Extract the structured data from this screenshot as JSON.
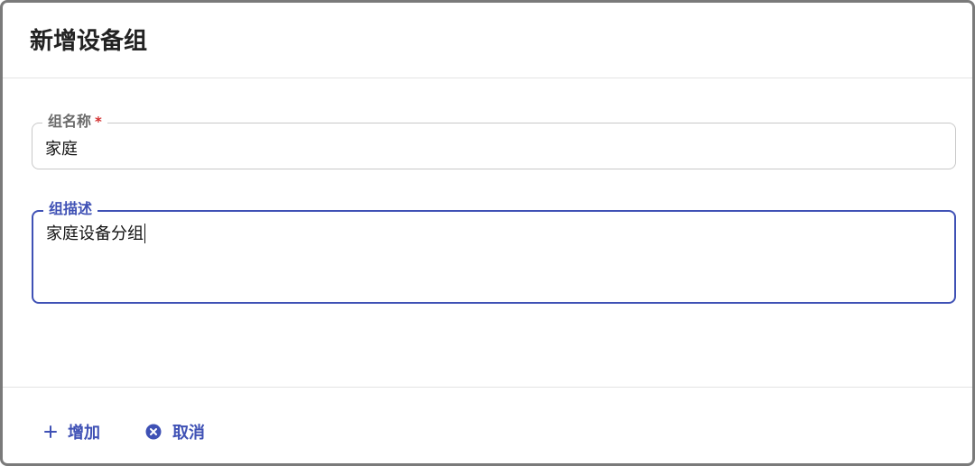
{
  "dialog": {
    "title": "新增设备组"
  },
  "form": {
    "group_name": {
      "label": "组名称",
      "required_mark": "*",
      "value": "家庭"
    },
    "group_description": {
      "label": "组描述",
      "value": "家庭设备分组"
    }
  },
  "actions": {
    "add": {
      "label": "增加",
      "icon": "plus-icon"
    },
    "cancel": {
      "label": "取消",
      "icon": "cancel-circle-icon"
    }
  },
  "colors": {
    "accent": "#3f51b5",
    "required": "#d32f2f"
  }
}
